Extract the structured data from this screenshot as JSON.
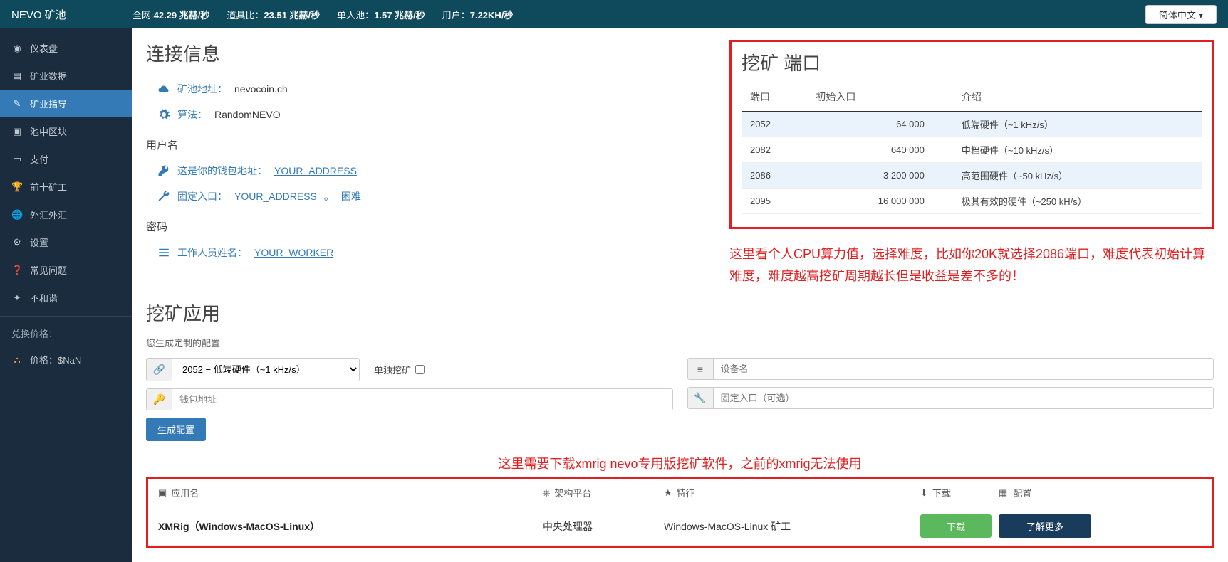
{
  "topbar": {
    "brand": "NEVO 矿池",
    "stats": [
      {
        "label": "全网:",
        "value": "42.29 兆赫/秒"
      },
      {
        "label": "道具比：",
        "value": "23.51 兆赫/秒"
      },
      {
        "label": "单人池：",
        "value": "1.57 兆赫/秒"
      },
      {
        "label": "用户：",
        "value": "7.22KH/秒"
      }
    ],
    "lang": "简体中文 ▾"
  },
  "sidebar": {
    "items": [
      {
        "label": "仪表盘",
        "icon": "dashboard"
      },
      {
        "label": "矿业数据",
        "icon": "chart"
      },
      {
        "label": "矿业指导",
        "icon": "pencil",
        "active": true
      },
      {
        "label": "池中区块",
        "icon": "cubes"
      },
      {
        "label": "支付",
        "icon": "money"
      },
      {
        "label": "前十矿工",
        "icon": "trophy"
      },
      {
        "label": "外汇外汇",
        "icon": "globe"
      },
      {
        "label": "设置",
        "icon": "gear"
      },
      {
        "label": "常见问题",
        "icon": "question"
      },
      {
        "label": "不和谐",
        "icon": "discord"
      }
    ],
    "priceGroup": "兑换价格：",
    "priceLine": "价格：$NaN"
  },
  "connection": {
    "title": "连接信息",
    "poolAddrLabel": "矿池地址：",
    "poolAddr": "nevocoin.ch",
    "algoLabel": "算法：",
    "algo": "RandomNEVO",
    "userTitle": "用户名",
    "walletLabel": "这是你的钱包地址：",
    "walletValue": "YOUR_ADDRESS",
    "fixedLabel": "固定入口：",
    "fixedValue": "YOUR_ADDRESS",
    "fixedDiff": "困难",
    "passTitle": "密码",
    "workerLabel": "工作人员姓名：",
    "workerValue": "YOUR_WORKER"
  },
  "ports": {
    "title": "挖矿 端口",
    "headers": {
      "port": "端口",
      "diff": "初始入口",
      "desc": "介绍"
    },
    "rows": [
      {
        "port": "2052",
        "diff": "64 000",
        "desc": "低端硬件（~1 kHz/s）"
      },
      {
        "port": "2082",
        "diff": "640 000",
        "desc": "中档硬件（~10 kHz/s）"
      },
      {
        "port": "2086",
        "diff": "3 200 000",
        "desc": "高范围硬件（~50 kHz/s）"
      },
      {
        "port": "2095",
        "diff": "16 000 000",
        "desc": "极其有效的硬件（~250 kH/s）"
      }
    ]
  },
  "annotation1": "这里看个人CPU算力值，选择难度，比如你20K就选择2086端口，难度代表初始计算难度，难度越高挖矿周期越长但是收益是差不多的！",
  "mining": {
    "title": "挖矿应用",
    "hint": "您生成定制的配置",
    "portSelected": "2052 − 低端硬件（~1 kHz/s）",
    "soloLabel": "单独挖矿",
    "walletPlaceholder": "钱包地址",
    "devicePlaceholder": "设备名",
    "diffPlaceholder": "固定入口（可选）",
    "genBtn": "生成配置"
  },
  "annotation2": "这里需要下载xmrig nevo专用版挖矿软件，之前的xmrig无法使用",
  "apps": {
    "headers": {
      "name": "应用名",
      "arch": "架构平台",
      "feat": "特征",
      "dl": "下载",
      "cfg": "配置"
    },
    "row": {
      "name": "XMRig（Windows-MacOS-Linux）",
      "arch": "中央处理器",
      "feat": "Windows-MacOS-Linux 矿工",
      "dl": "下载",
      "more": "了解更多"
    }
  }
}
